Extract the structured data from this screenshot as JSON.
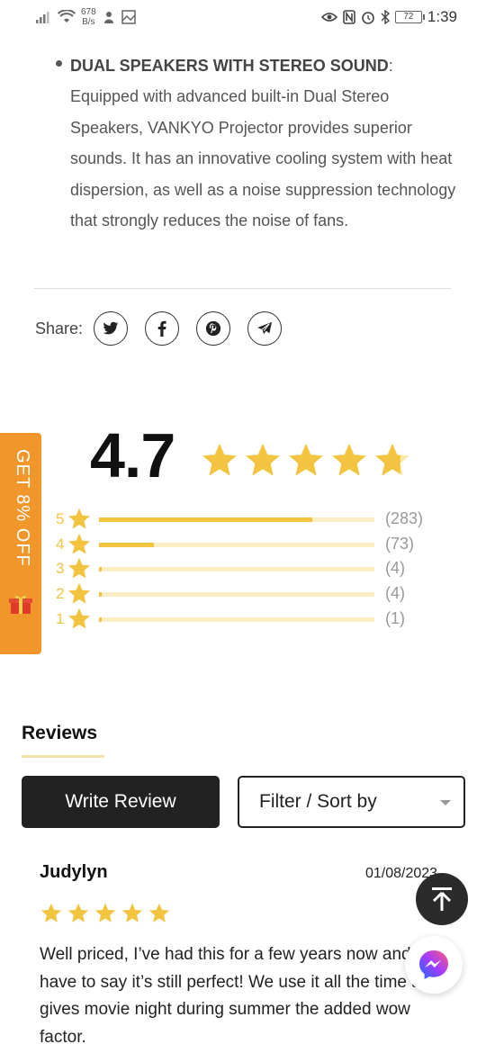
{
  "status_bar": {
    "net_speed_value": "678",
    "net_speed_unit": "B/s",
    "battery": "72",
    "time": "1:39"
  },
  "description": {
    "title": "DUAL SPEAKERS WITH STEREO SOUND",
    "colon": ":",
    "body": "Equipped with advanced built-in Dual Stereo Speakers, VANKYO Projector provides superior sounds. It has an innovative cooling system with heat dispersion, as well as a noise suppression technology that strongly reduces the noise of fans."
  },
  "share": {
    "label": "Share:",
    "buttons": [
      "twitter-icon",
      "facebook-icon",
      "pinterest-icon",
      "telegram-icon"
    ]
  },
  "side_tab": {
    "label": "GET 8% OFF"
  },
  "rating": {
    "average": "4.7",
    "average_value": 4.7,
    "distribution": [
      {
        "stars": "5",
        "count_label": "(283)",
        "count": 283
      },
      {
        "stars": "4",
        "count_label": "(73)",
        "count": 73
      },
      {
        "stars": "3",
        "count_label": "(4)",
        "count": 4
      },
      {
        "stars": "2",
        "count_label": "(4)",
        "count": 4
      },
      {
        "stars": "1",
        "count_label": "(1)",
        "count": 1
      }
    ]
  },
  "reviews": {
    "heading": "Reviews",
    "write_button": "Write Review",
    "filter_label": "Filter / Sort by",
    "items": [
      {
        "author": "Judylyn",
        "date": "01/08/2023",
        "rating": 5,
        "text": "Well priced, I’ve had this for a few years now and I have to say it’s still perfect! We use it all the time and gives movie night during summer the added wow factor."
      }
    ]
  },
  "colors": {
    "star": "#f3c440",
    "star_track": "#fbedc4",
    "side_tab": "#f0962a",
    "button_dark": "#222222"
  }
}
